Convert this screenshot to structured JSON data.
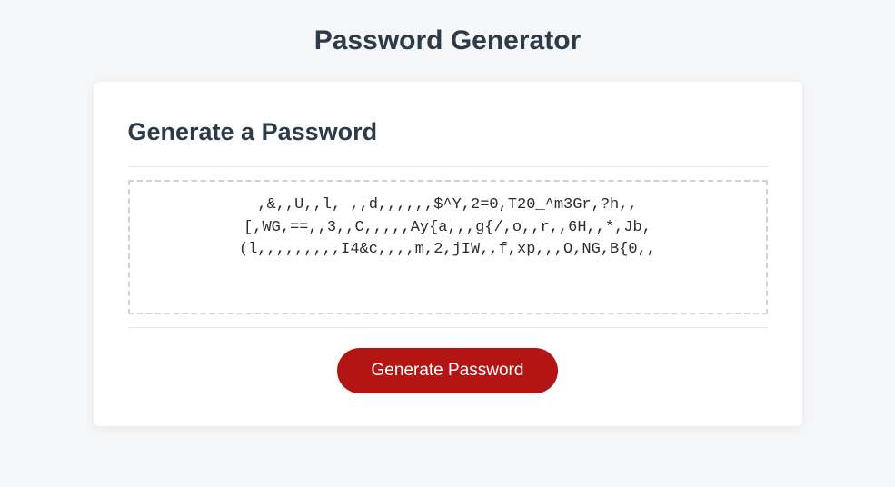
{
  "header": {
    "title": "Password Generator"
  },
  "card": {
    "title": "Generate a Password",
    "password_lines": [
      ",&,,U,,l, ,,d,,,,,,$^Y,2=0,T20_^m3Gr,?h,,",
      "[,WG,==,,3,,C,,,,,Ay{a,,,g{/,o,,r,,6H,,*,Jb,",
      "(l,,,,,,,,,I4&c,,,,m,2,jIW,,f,xp,,,O,NG,B{0,,"
    ],
    "button_label": "Generate Password"
  }
}
